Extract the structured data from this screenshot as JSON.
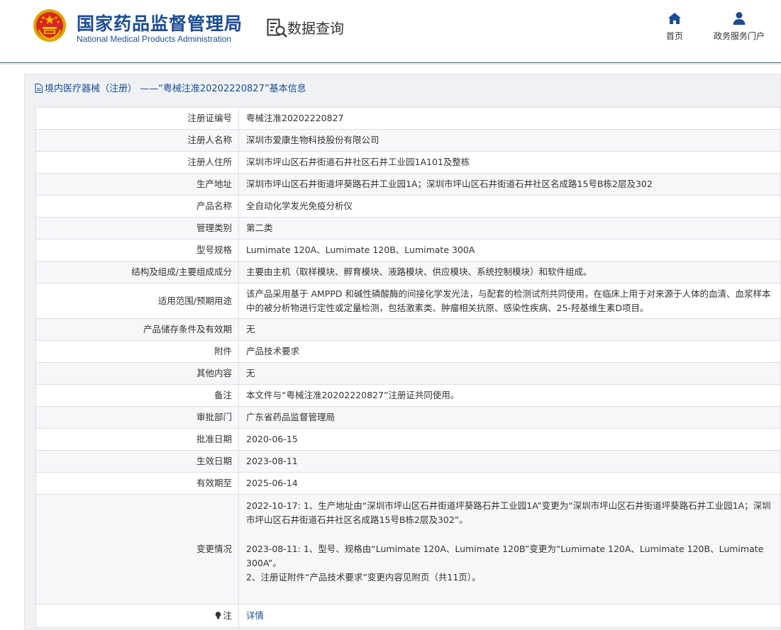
{
  "header": {
    "site_name": "国家药品监督管理局",
    "site_name_en": "National Medical Products Administration",
    "query_title": "数据查询",
    "nav": {
      "home": "首页",
      "portal": "政务服务门户"
    }
  },
  "panel": {
    "title": "境内医疗器械（注册） ——“粤械注准20202220827”基本信息"
  },
  "rows": [
    {
      "label": "注册证编号",
      "value": "粤械注准20202220827"
    },
    {
      "label": "注册人名称",
      "value": "深圳市爱康生物科技股份有限公司"
    },
    {
      "label": "注册人住所",
      "value": "深圳市坪山区石井街道石井社区石井工业园1A101及整栋"
    },
    {
      "label": "生产地址",
      "value": "深圳市坪山区石井街道坪葵路石井工业园1A；深圳市坪山区石井街道石井社区名成路15号B栋2层及302"
    },
    {
      "label": "产品名称",
      "value": "全自动化学发光免疫分析仪"
    },
    {
      "label": "管理类别",
      "value": "第二类"
    },
    {
      "label": "型号规格",
      "value": "Lumimate 120A、Lumimate 120B、Lumimate 300A"
    },
    {
      "label": "结构及组成/主要组成成分",
      "value": "主要由主机（取样模块、孵育模块、液路模块、供应模块、系统控制模块）和软件组成。"
    },
    {
      "label": "适用范围/预期用途",
      "value": "该产品采用基于 AMPPD 和碱性磷酸酶的间接化学发光法，与配套的检测试剂共同使用，在临床上用于对来源于人体的血清、血浆样本中的被分析物进行定性或定量检测，包括激素类、肿瘤相关抗原、感染性疾病、25-羟基维生素D项目。"
    },
    {
      "label": "产品储存条件及有效期",
      "value": "无"
    },
    {
      "label": "附件",
      "value": "产品技术要求"
    },
    {
      "label": "其他内容",
      "value": "无"
    },
    {
      "label": "备注",
      "value": "本文件与“粤械注准20202220827”注册证共同使用。"
    },
    {
      "label": "审批部门",
      "value": "广东省药品监督管理局"
    },
    {
      "label": "批准日期",
      "value": "2020-06-15"
    },
    {
      "label": "生效日期",
      "value": "2023-08-11"
    },
    {
      "label": "有效期至",
      "value": "2025-06-14"
    }
  ],
  "changes": {
    "label": "变更情况",
    "entry1": "2022-10-17: 1、生产地址由“深圳市坪山区石井街道坪葵路石井工业园1A”变更为“深圳市坪山区石井街道坪葵路石井工业园1A；深圳市坪山区石井街道石井社区名成路15号B栋2层及302”。",
    "entry2_line1": "2023-08-11: 1、型号、规格由“Lumimate 120A、Lumimate 120B”变更为“Lumimate 120A、Lumimate 120B、Lumimate 300A”。",
    "entry2_line2": "2、注册证附件“产品技术要求”变更内容见附页（共11页）。"
  },
  "note": {
    "label": "注",
    "link": "详情"
  },
  "colors": {
    "brand": "#1c4d94",
    "emblem_red": "#d7261d",
    "emblem_gold": "#f2c200"
  },
  "icons": {
    "home": "home-icon",
    "portal": "user-icon",
    "query": "document-search-icon",
    "title": "document-icon",
    "note": "lightbulb-icon"
  }
}
